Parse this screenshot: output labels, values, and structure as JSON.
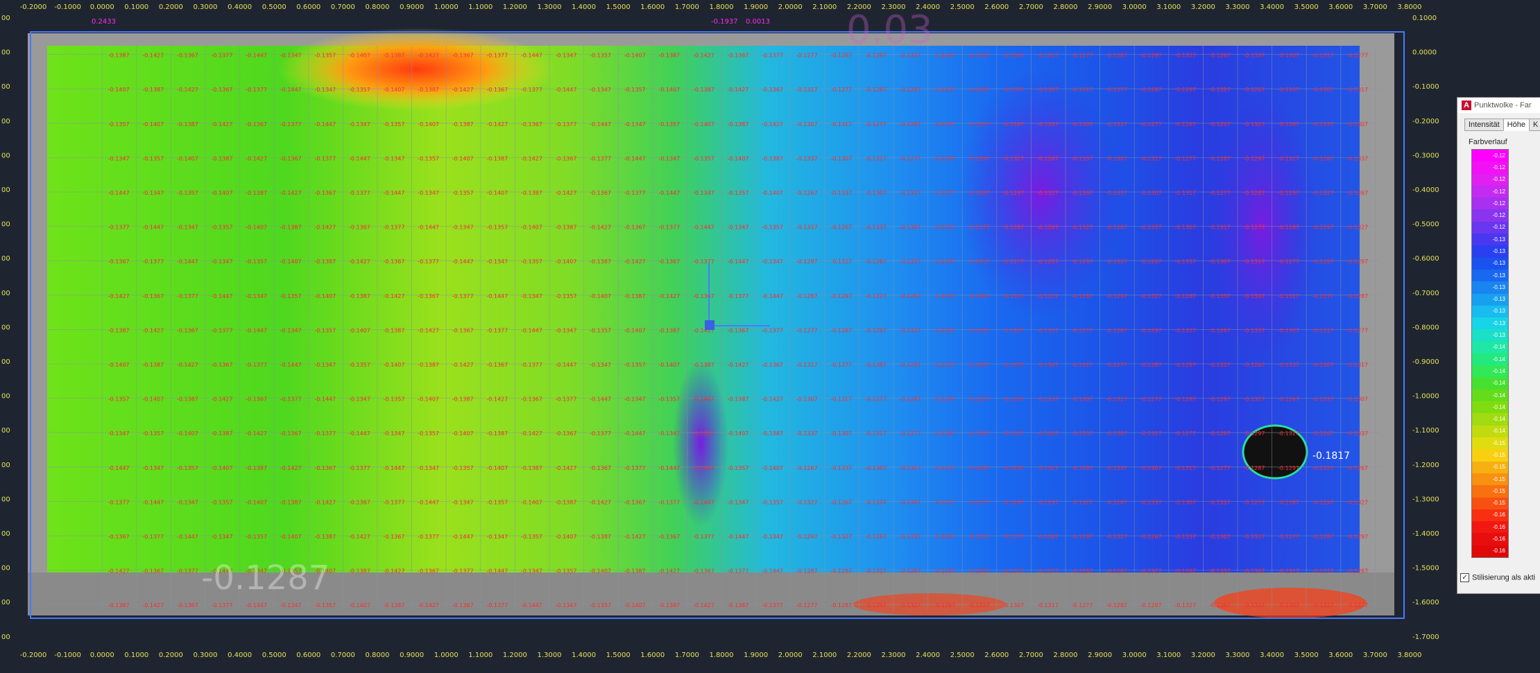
{
  "x_ticks": [
    "-0.2000",
    "-0.1000",
    "0.0000",
    "0.1000",
    "0.2000",
    "0.3000",
    "0.4000",
    "0.5000",
    "0.6000",
    "0.7000",
    "0.8000",
    "0.9000",
    "1.0000",
    "1.1000",
    "1.2000",
    "1.3000",
    "1.4000",
    "1.5000",
    "1.6000",
    "1.7000",
    "1.8000",
    "1.9000",
    "2.0000",
    "2.1000",
    "2.2000",
    "2.3000",
    "2.4000",
    "2.5000",
    "2.6000",
    "2.7000",
    "2.8000",
    "2.9000",
    "3.0000",
    "3.1000",
    "3.2000",
    "3.3000",
    "3.4000",
    "3.5000",
    "3.6000",
    "3.7000",
    "3.8000"
  ],
  "y_ticks": [
    "0.1000",
    "0.0000",
    "-0.1000",
    "-0.2000",
    "-0.3000",
    "-0.4000",
    "-0.5000",
    "-0.6000",
    "-0.7000",
    "-0.8000",
    "-0.9000",
    "-1.0000",
    "-1.1000",
    "-1.2000",
    "-1.3000",
    "-1.4000",
    "-1.5000",
    "-1.6000",
    "-1.7000"
  ],
  "cell_values": {
    "green_zone": [
      "-0.1407",
      "-0.1367",
      "-0.1347",
      "-0.1387",
      "-0.1377",
      "-0.1357",
      "-0.1427",
      "-0.1447"
    ],
    "blue_zone": [
      "-0.1327",
      "-0.1307",
      "-0.1287",
      "-0.1267",
      "-0.1317",
      "-0.1297",
      "-0.1337",
      "-0.1277"
    ]
  },
  "overlay_labels": {
    "top_left_marker": "0.2433",
    "top_mid_a": "-0.1937",
    "top_mid_b": "0.0013",
    "hole_value": "-0.1817",
    "faint_left": "-0.1287",
    "faint_right": "0.03"
  },
  "colors": {
    "background": "#1e2530",
    "axis_text": "#e8e05a",
    "value_text": "#ff2a2a",
    "grid_line": "#8a92a0",
    "frame": "#4a78ff"
  },
  "panel": {
    "title": "Punktwolke - Far",
    "tabs": [
      "Intensität",
      "Höhe",
      "K"
    ],
    "gradient_label": "Farbverlauf",
    "gradient_values": [
      "-0.12",
      "-0.12",
      "-0.12",
      "-0.12",
      "-0.12",
      "-0.12",
      "-0.12",
      "-0.13",
      "-0.13",
      "-0.13",
      "-0.13",
      "-0.13",
      "-0.13",
      "-0.13",
      "-0.13",
      "-0.13",
      "-0.14",
      "-0.14",
      "-0.14",
      "-0.14",
      "-0.14",
      "-0.14",
      "-0.14",
      "-0.14",
      "-0.15",
      "-0.15",
      "-0.15",
      "-0.15",
      "-0.15",
      "-0.15",
      "-0.16",
      "-0.16",
      "-0.16",
      "-0.16"
    ],
    "stylize_label": "Stilisierung als akti"
  }
}
